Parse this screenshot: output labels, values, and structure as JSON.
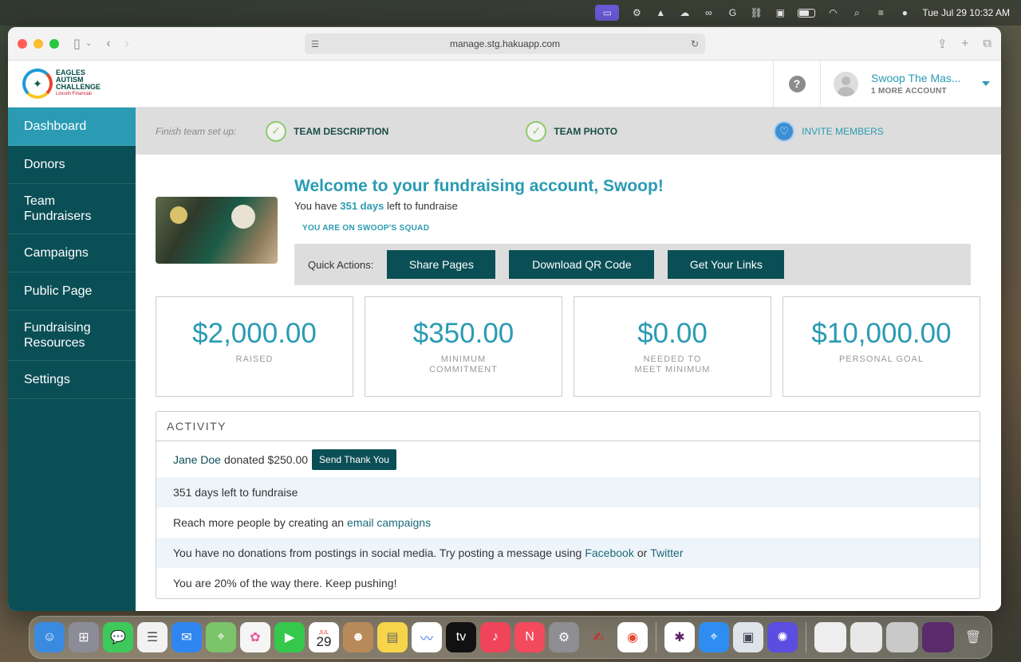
{
  "menubar": {
    "clock": "Tue Jul 29  10:32 AM"
  },
  "browser": {
    "url": "manage.stg.hakuapp.com"
  },
  "header": {
    "logo_line1": "EAGLES",
    "logo_line2": "AUTISM",
    "logo_line3": "CHALLENGE",
    "logo_sponsor": "Lincoln Financial",
    "help_icon": "?",
    "account_name": "Swoop The Mas...",
    "account_more": "1 MORE ACCOUNT"
  },
  "sidebar": {
    "items": [
      {
        "label": "Dashboard"
      },
      {
        "label": "Donors"
      },
      {
        "label": "Team Fundraisers"
      },
      {
        "label": "Campaigns"
      },
      {
        "label": "Public Page"
      },
      {
        "label": "Fundraising Resources"
      },
      {
        "label": "Settings"
      }
    ]
  },
  "setup": {
    "label": "Finish team set up:",
    "steps": [
      {
        "label": "TEAM DESCRIPTION"
      },
      {
        "label": "TEAM PHOTO"
      },
      {
        "label": "INVITE MEMBERS"
      }
    ]
  },
  "welcome": {
    "title": "Welcome to your fundraising account, Swoop!",
    "days_prefix": "You have",
    "days": "351 days",
    "days_suffix": "left to fundraise",
    "squad": "YOU ARE ON SWOOP'S SQUAD"
  },
  "quick_actions": {
    "label": "Quick Actions:",
    "buttons": [
      {
        "label": "Share Pages"
      },
      {
        "label": "Download QR Code"
      },
      {
        "label": "Get Your Links"
      }
    ]
  },
  "stats": [
    {
      "value": "$2,000.00",
      "label": "RAISED"
    },
    {
      "value": "$350.00",
      "label": "MINIMUM COMMITMENT"
    },
    {
      "value": "$0.00",
      "label": "NEEDED TO MEET MINIMUM"
    },
    {
      "value": "$10,000.00",
      "label": "PERSONAL GOAL"
    }
  ],
  "activity": {
    "title": "ACTIVITY",
    "donor_name": "Jane Doe",
    "donation_text": "donated $250.00",
    "thank_button": "Send Thank You",
    "row2": "351 days left to fundraise",
    "row3_prefix": "Reach more people by creating an",
    "row3_link": "email campaigns",
    "row4_prefix": "You have no donations from postings in social media. Try posting a message using",
    "row4_link1": "Facebook",
    "row4_mid": "or",
    "row4_link2": "Twitter",
    "row5": "You are 20% of the way there. Keep pushing!"
  },
  "dock": {
    "calendar_month": "JUL",
    "calendar_day": "29"
  },
  "colors": {
    "sidebar": "#0b4f56",
    "accent": "#2a9bb3",
    "button": "#0b4f56"
  }
}
